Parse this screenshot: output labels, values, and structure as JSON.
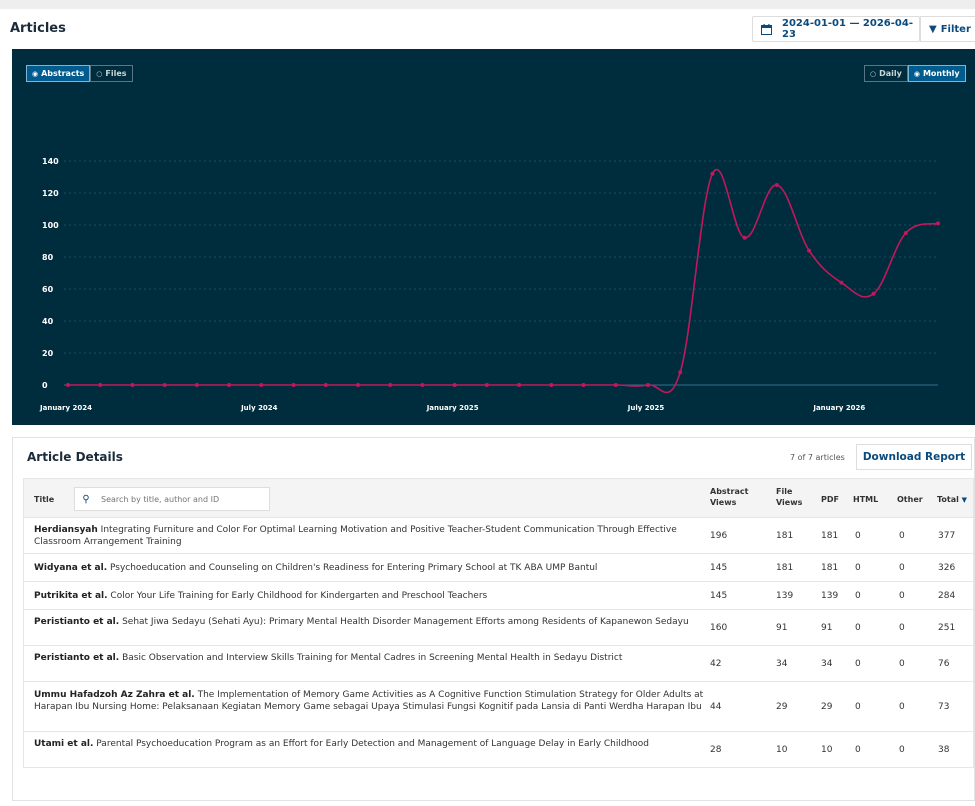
{
  "header": {
    "title": "Articles",
    "date_range": "2024-01-01 — 2026-04-23",
    "filter_label": "Filter"
  },
  "chart_toggles": {
    "abstracts": "Abstracts",
    "files": "Files",
    "daily": "Daily",
    "monthly": "Monthly"
  },
  "chart_data": {
    "type": "line",
    "x": [
      "2024-01",
      "2024-02",
      "2024-03",
      "2024-04",
      "2024-05",
      "2024-06",
      "2024-07",
      "2024-08",
      "2024-09",
      "2024-10",
      "2024-11",
      "2024-12",
      "2025-01",
      "2025-02",
      "2025-03",
      "2025-04",
      "2025-05",
      "2025-06",
      "2025-07",
      "2025-08",
      "2025-09",
      "2025-10",
      "2025-11",
      "2025-12",
      "2026-01",
      "2026-02",
      "2026-03",
      "2026-04"
    ],
    "series": [
      {
        "values": [
          0,
          0,
          0,
          0,
          0,
          0,
          0,
          0,
          0,
          0,
          0,
          0,
          0,
          0,
          0,
          0,
          0,
          0,
          0,
          8,
          132,
          92,
          125,
          84,
          64,
          57,
          95,
          101
        ],
        "color": "#c2185b"
      }
    ],
    "xticks": [
      "January 2024",
      "July 2024",
      "January 2025",
      "July 2025",
      "January 2026"
    ],
    "xtick_index": [
      0,
      6,
      12,
      18,
      24
    ],
    "yticks": [
      0,
      20,
      40,
      60,
      80,
      100,
      120,
      140
    ],
    "ylim": [
      0,
      150
    ],
    "grid": true
  },
  "details": {
    "title": "Article Details",
    "count": "7 of 7 articles",
    "download_label": "Download Report",
    "search_placeholder": "Search by title, author and ID",
    "columns": {
      "title": "Title",
      "abstract_views": "Abstract Views",
      "file_views": "File Views",
      "pdf": "PDF",
      "html": "HTML",
      "other": "Other",
      "total": "Total"
    },
    "rows": [
      {
        "author": "Herdiansyah",
        "title": "Integrating Furniture and Color For Optimal Learning Motivation and Positive Teacher-Student Communication Through Effective Classroom Arrangement Training",
        "abstract_views": "196",
        "file_views": "181",
        "pdf": "181",
        "html": "0",
        "other": "0",
        "total": "377"
      },
      {
        "author": "Widyana et al.",
        "title": "Psychoeducation and Counseling on Children's Readiness for Entering Primary School at TK ABA UMP Bantul",
        "abstract_views": "145",
        "file_views": "181",
        "pdf": "181",
        "html": "0",
        "other": "0",
        "total": "326"
      },
      {
        "author": "Putrikita et al.",
        "title": "Color Your Life Training for Early Childhood for Kindergarten and Preschool Teachers",
        "abstract_views": "145",
        "file_views": "139",
        "pdf": "139",
        "html": "0",
        "other": "0",
        "total": "284"
      },
      {
        "author": "Peristianto et al.",
        "title": "Sehat Jiwa Sedayu (Sehati Ayu): Primary Mental Health Disorder Management Efforts among Residents of Kapanewon Sedayu",
        "abstract_views": "160",
        "file_views": "91",
        "pdf": "91",
        "html": "0",
        "other": "0",
        "total": "251"
      },
      {
        "author": "Peristianto et al.",
        "title": "Basic Observation and Interview Skills Training for Mental Cadres in Screening Mental Health in Sedayu District",
        "abstract_views": "42",
        "file_views": "34",
        "pdf": "34",
        "html": "0",
        "other": "0",
        "total": "76"
      },
      {
        "author": "Ummu Hafadzoh Az Zahra et al.",
        "title": "The Implementation of Memory Game Activities as A Cognitive Function Stimulation Strategy for Older Adults at Harapan Ibu Nursing Home: Pelaksanaan Kegiatan Memory Game sebagai Upaya Stimulasi Fungsi Kognitif pada Lansia di Panti Werdha Harapan Ibu",
        "abstract_views": "44",
        "file_views": "29",
        "pdf": "29",
        "html": "0",
        "other": "0",
        "total": "73"
      },
      {
        "author": "Utami et al.",
        "title": "Parental Psychoeducation Program as an Effort for Early Detection and Management of Language Delay in Early Childhood",
        "abstract_views": "28",
        "file_views": "10",
        "pdf": "10",
        "html": "0",
        "other": "0",
        "total": "38"
      }
    ]
  }
}
